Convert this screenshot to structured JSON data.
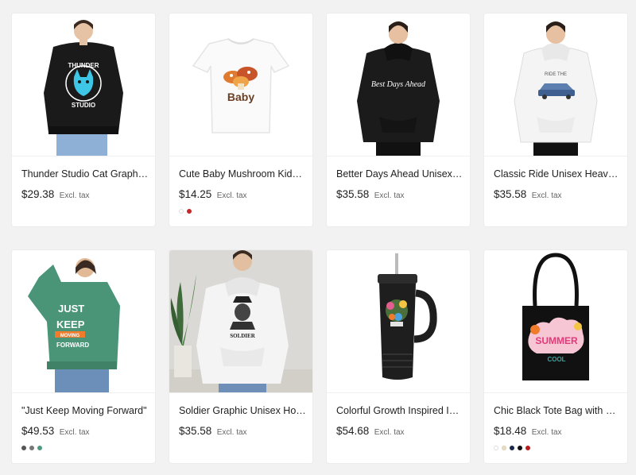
{
  "products": [
    {
      "title": "Thunder Studio Cat Graphic Sweatshirt",
      "price": "$29.38",
      "tax": "Excl. tax",
      "swatches": []
    },
    {
      "title": "Cute Baby Mushroom Kids Tee",
      "price": "$14.25",
      "tax": "Excl. tax",
      "swatches": [
        "#ffffff",
        "#c62828"
      ]
    },
    {
      "title": "Better Days Ahead Unisex Heavy Blend Hoodie",
      "price": "$35.58",
      "tax": "Excl. tax",
      "swatches": []
    },
    {
      "title": "Classic Ride Unisex Heavy Blend Hoodie",
      "price": "$35.58",
      "tax": "Excl. tax",
      "swatches": []
    },
    {
      "title": "\"Just Keep Moving Forward\"",
      "price": "$49.53",
      "tax": "Excl. tax",
      "swatches": [
        "#555555",
        "#777777",
        "#4e9a7e"
      ]
    },
    {
      "title": "Soldier Graphic Unisex Hoodie",
      "price": "$35.58",
      "tax": "Excl. tax",
      "swatches": []
    },
    {
      "title": "Colorful Growth Inspired Insulated Tumbler",
      "price": "$54.68",
      "tax": "Excl. tax",
      "swatches": []
    },
    {
      "title": "Chic Black Tote Bag with Playful Summer Design",
      "price": "$18.48",
      "tax": "Excl. tax",
      "swatches": [
        "#ffffff",
        "#e8dcc0",
        "#1c2a4a",
        "#111111",
        "#b71c1c"
      ]
    }
  ],
  "artwork": {
    "thunder_top": "THUNDER",
    "thunder_bottom": "STUDIO",
    "baby": "Baby",
    "better_days": "Best Days Ahead",
    "classic_ride": "RIDE THE",
    "just_keep": [
      "JUST",
      "KEEP",
      "MOVING",
      "FORWARD"
    ],
    "soldier": "SOLDIER",
    "summer": "SUMMER",
    "summer_sub": "COOL"
  },
  "colors": {
    "thunder_sweater": "#1a1a1a",
    "green_sweater": "#4a9477",
    "hoodie_black": "#1b1b1b",
    "hoodie_white": "#f4f4f4",
    "accent_red": "#c62828"
  }
}
